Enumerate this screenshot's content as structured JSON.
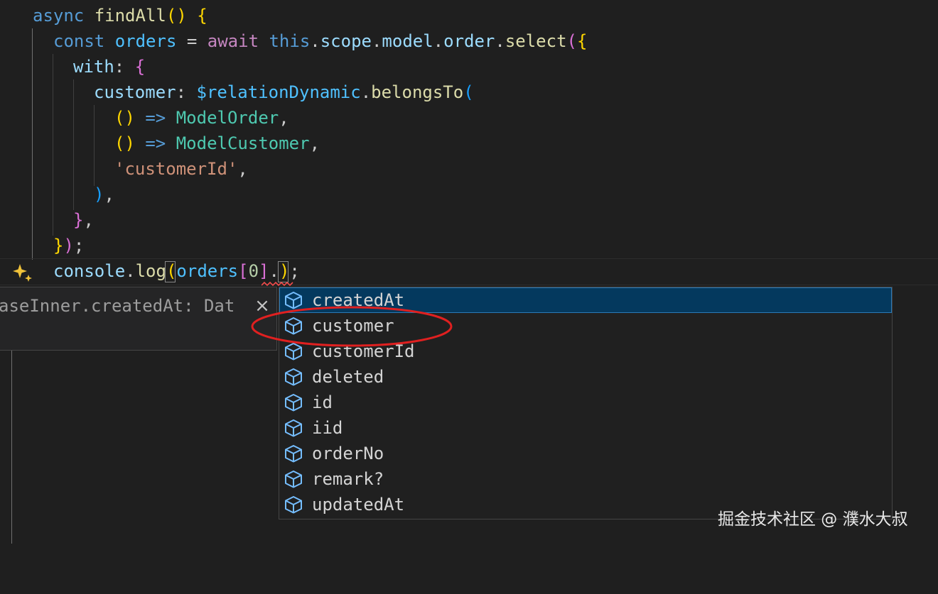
{
  "code": {
    "line1": {
      "kw": "async",
      "fn": "findAll",
      "open": "(",
      "close": ")",
      "brace": "{"
    },
    "line2": {
      "kw": "const",
      "var": "orders",
      "eq": "=",
      "await": "await",
      "this": "this",
      "dot1": ".",
      "scope": "scope",
      "dot2": ".",
      "model": "model",
      "dot3": ".",
      "order": "order",
      "dot4": ".",
      "select": "select",
      "paren": "(",
      "brace": "{"
    },
    "line3": {
      "key": "with",
      "colon": ":",
      "brace": "{"
    },
    "line4": {
      "key": "customer",
      "colon": ":",
      "obj": "$relationDynamic",
      "dot": ".",
      "fn": "belongsTo",
      "paren": "("
    },
    "line5": {
      "parens": "()",
      "arrow": "=>",
      "type": "ModelOrder",
      "comma": ","
    },
    "line6": {
      "parens": "()",
      "arrow": "=>",
      "type": "ModelCustomer",
      "comma": ","
    },
    "line7": {
      "str": "'customerId'",
      "comma": ","
    },
    "line8": {
      "paren": ")",
      "comma": ","
    },
    "line9": {
      "brace": "}",
      "comma": ","
    },
    "line10": {
      "brace": "}",
      "paren": ")",
      "semi": ";"
    },
    "line11": {
      "obj": "console",
      "dot": ".",
      "fn": "log",
      "paren": "(",
      "var": "orders",
      "idx_open": "[",
      "idx": "0",
      "idx_close": "]",
      "dot2": ".",
      "close": ")",
      "semi": ";"
    }
  },
  "hover": {
    "text": "aseInner.createdAt: Dat",
    "close_glyph": "×"
  },
  "suggest": {
    "items": [
      {
        "label": "createdAt",
        "icon": "property-cube-icon"
      },
      {
        "label": "customer",
        "icon": "property-cube-icon"
      },
      {
        "label": "customerId",
        "icon": "property-cube-icon"
      },
      {
        "label": "deleted",
        "icon": "property-cube-icon"
      },
      {
        "label": "id",
        "icon": "property-cube-icon"
      },
      {
        "label": "iid",
        "icon": "property-cube-icon"
      },
      {
        "label": "orderNo",
        "icon": "property-cube-icon"
      },
      {
        "label": "remark?",
        "icon": "property-cube-icon"
      },
      {
        "label": "updatedAt",
        "icon": "property-cube-icon"
      }
    ],
    "selected_index": 0,
    "highlighted_item": "customer"
  },
  "watermark": "掘金技术社区 @ 濮水大叔",
  "colors": {
    "background": "#1f1f1f",
    "selection": "#04395e",
    "annotation": "#e02020",
    "icon": "#75beff"
  }
}
